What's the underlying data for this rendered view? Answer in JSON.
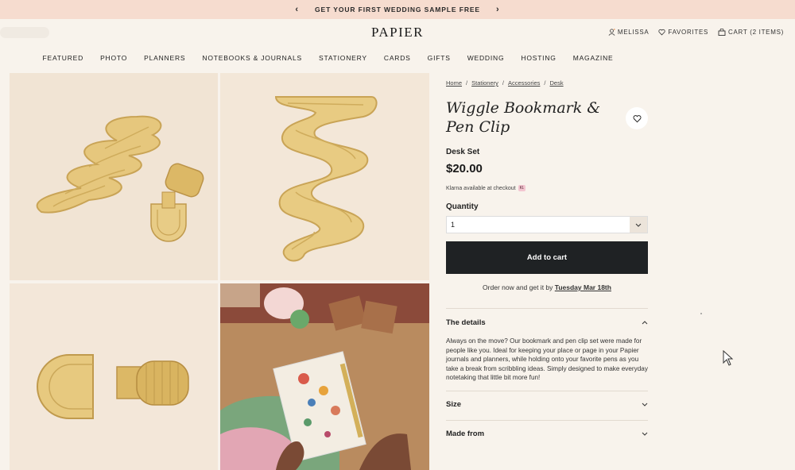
{
  "promo": {
    "text": "GET YOUR FIRST WEDDING SAMPLE FREE"
  },
  "header": {
    "logo": "PAPIER",
    "account": "MELISSA",
    "favorites": "FAVORITES",
    "cart": "CART (2 ITEMS)"
  },
  "nav": [
    "FEATURED",
    "PHOTO",
    "PLANNERS",
    "NOTEBOOKS & JOURNALS",
    "STATIONERY",
    "CARDS",
    "GIFTS",
    "WEDDING",
    "HOSTING",
    "MAGAZINE"
  ],
  "breadcrumb": [
    "Home",
    "Stationery",
    "Accessories",
    "Desk"
  ],
  "product": {
    "title_line1": "Wiggle Bookmark &",
    "title_line2": "Pen Clip",
    "variant": "Desk Set",
    "price": "$20.00",
    "klarna": "Klarna available at checkout",
    "quantity_label": "Quantity",
    "quantity_value": "1",
    "add_to_cart": "Add to cart",
    "order_text": "Order now and get it by",
    "order_date": "Tuesday Mar 18th"
  },
  "details": {
    "heading": "The details",
    "body": "Always on the move? Our bookmark and pen clip set were made for people like you. Ideal for keeping your place or page in your Papier journals and planners, while holding onto your favorite pens as you take a break from scribbling ideas. Simply designed to make everyday notetaking that little bit more fun!",
    "size": "Size",
    "made_from": "Made from"
  },
  "colors": {
    "promo_bg": "#f6dccf",
    "page_bg": "#f8f3ec",
    "button": "#1f2224",
    "gold": "#e2c378"
  },
  "icons": [
    "chevron-left-icon",
    "chevron-right-icon",
    "user-icon",
    "heart-icon",
    "bag-icon",
    "chevron-down-icon",
    "chevron-up-icon",
    "cursor-icon"
  ]
}
